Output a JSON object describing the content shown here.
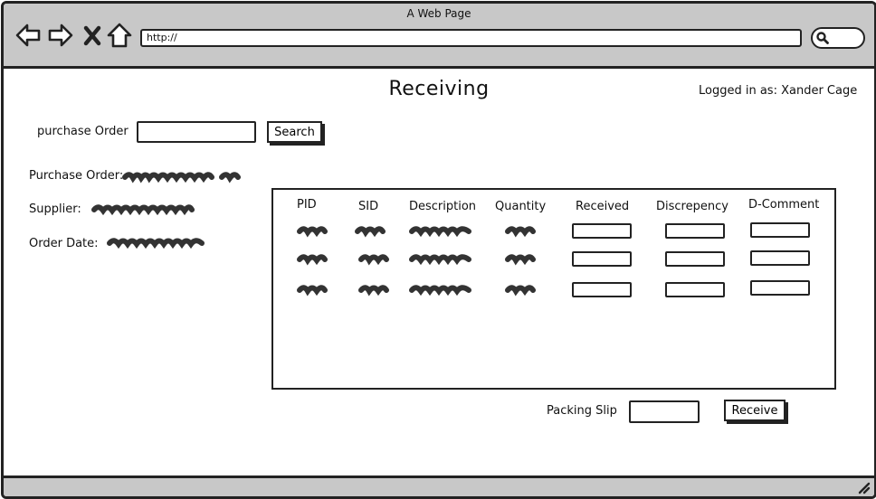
{
  "window": {
    "title": "A Web Page",
    "url": "http://"
  },
  "header": {
    "title": "Receiving",
    "logged_in": "Logged in as: Xander Cage"
  },
  "search": {
    "label": "purchase Order",
    "button": "Search"
  },
  "details": {
    "purchase_order_label": "Purchase Order:",
    "supplier_label": "Supplier:",
    "order_date_label": "Order Date:"
  },
  "table": {
    "columns": [
      "PID",
      "SID",
      "Description",
      "Quantity",
      "Received",
      "Discrepency",
      "D-Comment"
    ],
    "row_count": 3
  },
  "footer": {
    "packing_slip_label": "Packing Slip",
    "receive_button": "Receive"
  },
  "icons": [
    "back-arrow-icon",
    "forward-arrow-icon",
    "close-x-icon",
    "home-icon",
    "magnifier-icon",
    "resize-grip-icon"
  ]
}
